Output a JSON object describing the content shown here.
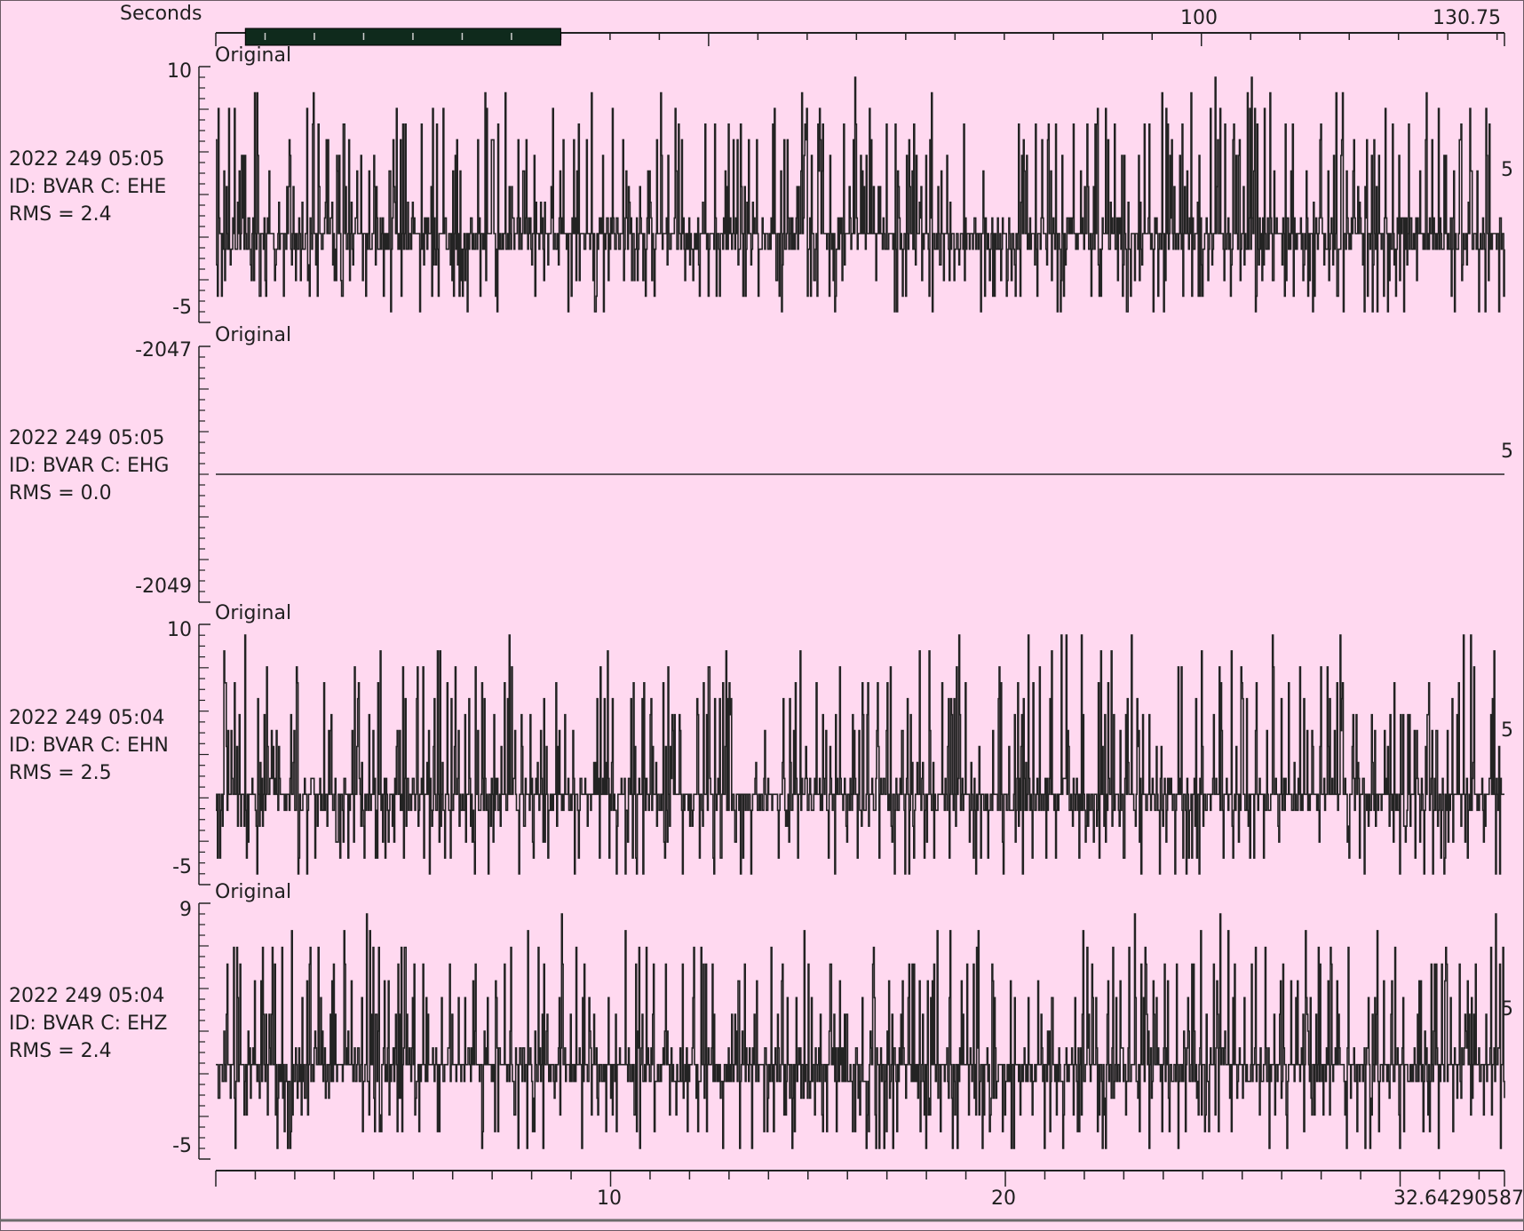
{
  "overview": {
    "axis_label": "Seconds",
    "tick_labels": [
      "100",
      "130.75"
    ],
    "time_range": [
      0,
      130.75
    ],
    "selection_range": [
      3,
      35
    ],
    "selection_color": "#0f2a1c"
  },
  "bottom_axis": {
    "tick_labels": [
      "10",
      "20",
      "32.64290587"
    ],
    "range": [
      0,
      32.64290587
    ]
  },
  "colors": {
    "background": "#ffd9f0",
    "trace": "#232323",
    "text": "#1f1f1f"
  },
  "channels": [
    {
      "date": "2022 249 05:05",
      "id_line": "ID: BVAR C: EHE",
      "rms": "RMS = 2.4",
      "panel_label": "Original",
      "ymax_label": "10",
      "ymin_label": "-5",
      "right_label": "5"
    },
    {
      "date": "2022 249 05:05",
      "id_line": "ID: BVAR C: EHG",
      "rms": "RMS = 0.0",
      "panel_label": "Original",
      "ymax_label": "-2047",
      "ymin_label": "-2049",
      "right_label": "5"
    },
    {
      "date": "2022 249 05:04",
      "id_line": "ID: BVAR C: EHN",
      "rms": "RMS = 2.5",
      "panel_label": "Original",
      "ymax_label": "10",
      "ymin_label": "-5",
      "right_label": "5"
    },
    {
      "date": "2022 249 05:04",
      "id_line": "ID: BVAR C: EHZ",
      "rms": "RMS = 2.4",
      "panel_label": "Original",
      "ymax_label": "9",
      "ymin_label": "-5",
      "right_label": "5"
    }
  ],
  "chart_data": [
    {
      "type": "line",
      "xlabel": "",
      "ylabel": "",
      "xlim": [
        0,
        32.64290587
      ],
      "ylim": [
        -5,
        10
      ],
      "series": [
        {
          "values_description_free": true,
          "mean": 0,
          "rms": 2.4,
          "min": -5,
          "max": 10
        }
      ]
    },
    {
      "type": "line",
      "xlabel": "",
      "ylabel": "",
      "xlim": [
        0,
        32.64290587
      ],
      "ylim": [
        -2049,
        -2047
      ],
      "series": [
        {
          "mean": -2048,
          "rms": 0.0,
          "min": -2048,
          "max": -2048
        }
      ]
    },
    {
      "type": "line",
      "xlabel": "",
      "ylabel": "",
      "xlim": [
        0,
        32.64290587
      ],
      "ylim": [
        -5,
        10
      ],
      "series": [
        {
          "mean": 0,
          "rms": 2.5,
          "min": -5,
          "max": 10
        }
      ]
    },
    {
      "type": "line",
      "xlabel": "",
      "ylabel": "",
      "xlim": [
        0,
        32.64290587
      ],
      "ylim": [
        -5,
        9
      ],
      "series": [
        {
          "mean": 0,
          "rms": 2.4,
          "min": -5,
          "max": 9
        }
      ]
    }
  ]
}
